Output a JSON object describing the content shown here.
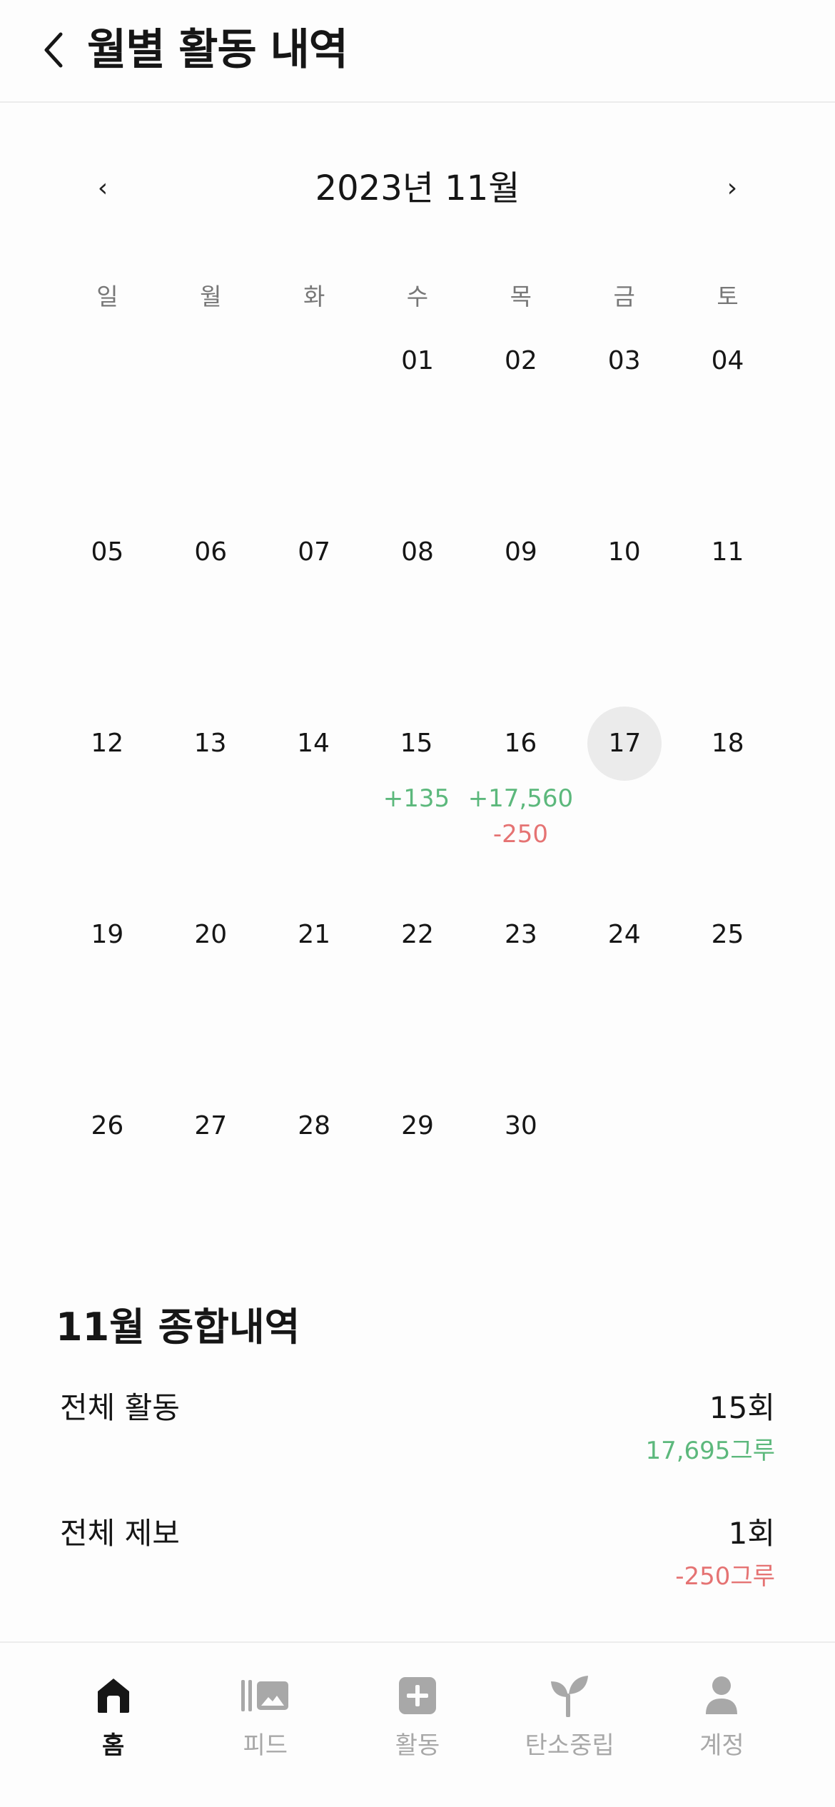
{
  "header": {
    "title": "월별 활동 내역"
  },
  "calendar": {
    "month_title": "2023년 11월",
    "prev_arrow": "‹",
    "next_arrow": "›",
    "weekdays": [
      "일",
      "월",
      "화",
      "수",
      "목",
      "금",
      "토"
    ],
    "weeks": [
      [
        null,
        null,
        null,
        {
          "day": "01"
        },
        {
          "day": "02"
        },
        {
          "day": "03"
        },
        {
          "day": "04"
        }
      ],
      [
        {
          "day": "05"
        },
        {
          "day": "06"
        },
        {
          "day": "07"
        },
        {
          "day": "08"
        },
        {
          "day": "09"
        },
        {
          "day": "10"
        },
        {
          "day": "11"
        }
      ],
      [
        {
          "day": "12"
        },
        {
          "day": "13"
        },
        {
          "day": "14"
        },
        {
          "day": "15",
          "plus": "+135"
        },
        {
          "day": "16",
          "plus": "+17,560",
          "minus": "-250"
        },
        {
          "day": "17",
          "today": true
        },
        {
          "day": "18"
        }
      ],
      [
        {
          "day": "19"
        },
        {
          "day": "20"
        },
        {
          "day": "21"
        },
        {
          "day": "22"
        },
        {
          "day": "23"
        },
        {
          "day": "24"
        },
        {
          "day": "25"
        }
      ],
      [
        {
          "day": "26"
        },
        {
          "day": "27"
        },
        {
          "day": "28"
        },
        {
          "day": "29"
        },
        {
          "day": "30"
        },
        null,
        null
      ]
    ]
  },
  "summary": {
    "title": "11월 종합내역",
    "activity": {
      "label": "전체 활동",
      "count": "15회",
      "sub": "17,695그루"
    },
    "report": {
      "label": "전체 제보",
      "count": "1회",
      "sub": "-250그루"
    }
  },
  "tabbar": {
    "items": [
      {
        "label": "홈",
        "icon": "home-icon",
        "active": true
      },
      {
        "label": "피드",
        "icon": "feed-icon",
        "active": false
      },
      {
        "label": "활동",
        "icon": "add-activity-icon",
        "active": false
      },
      {
        "label": "탄소중립",
        "icon": "sprout-icon",
        "active": false
      },
      {
        "label": "계정",
        "icon": "person-icon",
        "active": false
      }
    ]
  },
  "colors": {
    "positive": "#5cb87c",
    "negative": "#e57373",
    "today_highlight": "#ebebeb",
    "tab_inactive": "#a8a8a8"
  }
}
